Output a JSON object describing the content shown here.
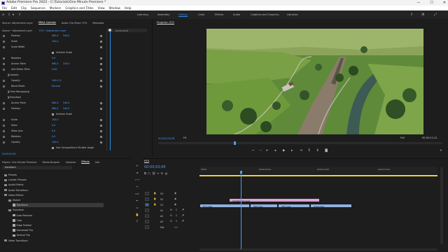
{
  "title_bar": {
    "title": "Adobe Premiere Pro 2022 - C:\\Tutorials\\One Minute Premiere *",
    "min": "—",
    "max": "☐",
    "close": "✕"
  },
  "menu": [
    "File",
    "Edit",
    "Clip",
    "Sequence",
    "Markers",
    "Graphics and Titles",
    "View",
    "Window",
    "Help"
  ],
  "workspaces": [
    "Learning",
    "Assembly",
    "Editing",
    "Color",
    "Effects",
    "Audio",
    "Captions and Graphics",
    "Libraries"
  ],
  "workspace_active": "Editing",
  "effect_controls": {
    "tabs": [
      "Source: Adjustment Layer",
      "Effect Controls",
      "Audio Clip Mixer: H74",
      "Metadata"
    ],
    "source": "Source • Adjustment Layer",
    "sequence": "H74 • Adjustment Layer",
    "clip_timecode": "00;00;00;00",
    "footer_timecode": "00;00;03;06",
    "rows": [
      {
        "name": "Position",
        "v1": "960.0",
        "v2": "540.0"
      },
      {
        "name": "Scale",
        "v1": "100.0",
        "v2": ""
      },
      {
        "name": "Scale Width",
        "v1": "",
        "v2": ""
      },
      {
        "name": "Uniform Scale",
        "v1": "",
        "v2": "",
        "check": true
      },
      {
        "name": "Rotation",
        "v1": "0.0",
        "v2": ""
      },
      {
        "name": "Anchor Point",
        "v1": "960.0",
        "v2": "540.0"
      },
      {
        "name": "Anti-flicker Filter",
        "v1": "0.00",
        "v2": ""
      },
      {
        "name": "Opacity",
        "v1": "",
        "v2": "",
        "section": true
      },
      {
        "name": "Opacity",
        "v1": "100.0 %",
        "v2": ""
      },
      {
        "name": "Blend Mode",
        "v1": "Normal",
        "v2": ""
      },
      {
        "name": "Time Remapping",
        "v1": "",
        "v2": "",
        "section": true
      },
      {
        "name": "Transform",
        "v1": "",
        "v2": "",
        "section": true
      },
      {
        "name": "Anchor Point",
        "v1": "960.0",
        "v2": "540.0"
      },
      {
        "name": "Position",
        "v1": "960.0",
        "v2": "540.0"
      },
      {
        "name": "Uniform Scale",
        "v1": "",
        "v2": "",
        "check": true
      },
      {
        "name": "Scale",
        "v1": "100.0",
        "v2": ""
      },
      {
        "name": "Skew",
        "v1": "0.0",
        "v2": ""
      },
      {
        "name": "Skew Axis",
        "v1": "0.0",
        "v2": ""
      },
      {
        "name": "Rotation",
        "v1": "0.0",
        "v2": ""
      },
      {
        "name": "Opacity",
        "v1": "100.0",
        "v2": ""
      },
      {
        "name": "Use Composition's Shutter Angle",
        "v1": "",
        "v2": "",
        "check": true
      }
    ]
  },
  "program": {
    "title": "Program: H74",
    "timecode": "00;00;03;06",
    "fit": "Fit",
    "quality": "Full",
    "duration": "00;00;11;21"
  },
  "project": {
    "tabs": [
      "Project: One Minute Premiere",
      "Media Browser",
      "Libraries",
      "Effects",
      "Info"
    ],
    "active_tab": "Effects",
    "search": "transform",
    "items": [
      {
        "label": "Presets",
        "kind": "folder",
        "indent": 0
      },
      {
        "label": "Lumetri Presets",
        "kind": "folder",
        "indent": 0
      },
      {
        "label": "Audio Effects",
        "kind": "folder",
        "indent": 0
      },
      {
        "label": "Audio Transitions",
        "kind": "folder",
        "indent": 0
      },
      {
        "label": "Video Effects",
        "kind": "folder",
        "indent": 0
      },
      {
        "label": "Distort",
        "kind": "folder",
        "indent": 1
      },
      {
        "label": "Transform",
        "kind": "fx",
        "indent": 2,
        "selected": true
      },
      {
        "label": "Transform",
        "kind": "folder",
        "indent": 1
      },
      {
        "label": "Auto Reframe",
        "kind": "fx",
        "indent": 2
      },
      {
        "label": "Crop",
        "kind": "fx",
        "indent": 2
      },
      {
        "label": "Edge Feather",
        "kind": "fx",
        "indent": 2
      },
      {
        "label": "Horizontal Flip",
        "kind": "fx",
        "indent": 2
      },
      {
        "label": "Vertical Flip",
        "kind": "fx",
        "indent": 2
      },
      {
        "label": "Video Transitions",
        "kind": "folder",
        "indent": 0
      }
    ]
  },
  "timeline": {
    "title": "H74",
    "timecode": "00;00;03;06",
    "ruler": [
      "00;00",
      "00;00;05;00",
      "00;00;10;00",
      "00;00;15;00"
    ],
    "tracks": [
      {
        "name": "V3",
        "kind": "v"
      },
      {
        "name": "V2",
        "kind": "v"
      },
      {
        "name": "V1",
        "kind": "v"
      },
      {
        "name": "A1",
        "kind": "a"
      },
      {
        "name": "A2",
        "kind": "a"
      },
      {
        "name": "A3",
        "kind": "a"
      },
      {
        "name": "Mix",
        "kind": "mix",
        "value": "0.0"
      }
    ],
    "clips": [
      {
        "label": "Adjustment Layer",
        "track": 1,
        "color": "#d7a4d4"
      },
      {
        "label": "H74.mp4",
        "track": 2,
        "color": "#8fb0e0"
      },
      {
        "label": "H85.mp4",
        "track": 2,
        "color": "#8fb0e0"
      },
      {
        "label": "H95.mp4",
        "track": 2,
        "color": "#8fb0e0"
      },
      {
        "label": "H103.mp4",
        "track": 2,
        "color": "#8fb0e0"
      }
    ]
  },
  "colors": {
    "accent": "#2d8ceb",
    "timecode": "#4aa0ff",
    "adjustment": "#d7a4d4",
    "video_clip": "#8fb0e0"
  }
}
